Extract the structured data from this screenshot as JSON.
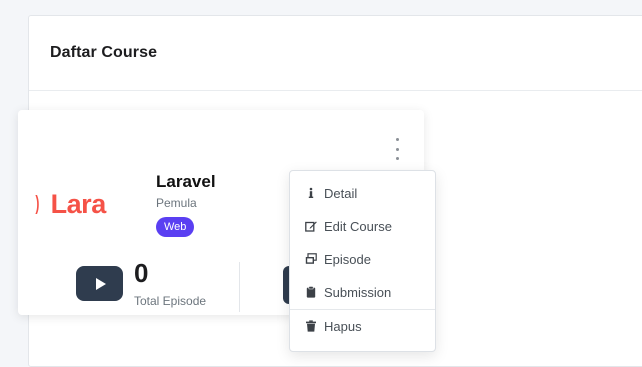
{
  "panel": {
    "title": "Daftar Course"
  },
  "course": {
    "logo_text": "Lara",
    "name": "Laravel",
    "level": "Pemula",
    "tag": "Web",
    "episode_count": "0",
    "episode_label": "Total Episode"
  },
  "menu": {
    "items": [
      {
        "label": "Detail",
        "icon": "info-icon"
      },
      {
        "label": "Edit Course",
        "icon": "edit-icon"
      },
      {
        "label": "Episode",
        "icon": "episodes-icon"
      },
      {
        "label": "Submission",
        "icon": "clipboard-icon"
      },
      {
        "label": "Hapus",
        "icon": "trash-icon"
      }
    ]
  },
  "colors": {
    "laravel_red": "#f55247",
    "tag_purple": "#5a3ff2",
    "dark_button": "#2f3c4e"
  }
}
